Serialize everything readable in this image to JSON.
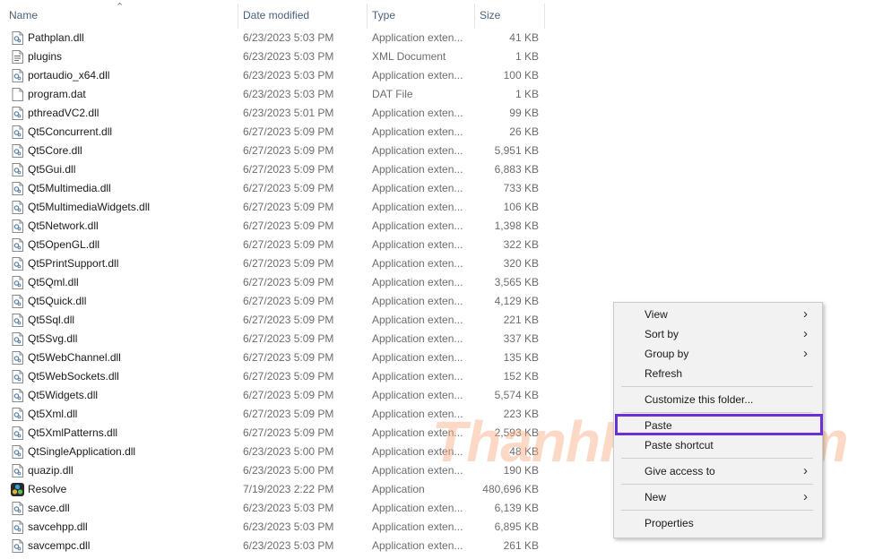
{
  "columns": {
    "name": "Name",
    "date": "Date modified",
    "type": "Type",
    "size": "Size"
  },
  "files": [
    {
      "name": "Pathplan.dll",
      "date": "6/23/2023 5:03 PM",
      "type": "Application exten...",
      "size": "41 KB",
      "icon": "dll-file-icon"
    },
    {
      "name": "plugins",
      "date": "6/23/2023 5:03 PM",
      "type": "XML Document",
      "size": "1 KB",
      "icon": "xml-file-icon"
    },
    {
      "name": "portaudio_x64.dll",
      "date": "6/23/2023 5:03 PM",
      "type": "Application exten...",
      "size": "100 KB",
      "icon": "dll-file-icon"
    },
    {
      "name": "program.dat",
      "date": "6/23/2023 5:03 PM",
      "type": "DAT File",
      "size": "1 KB",
      "icon": "blank-file-icon"
    },
    {
      "name": "pthreadVC2.dll",
      "date": "6/23/2023 5:01 PM",
      "type": "Application exten...",
      "size": "99 KB",
      "icon": "dll-file-icon"
    },
    {
      "name": "Qt5Concurrent.dll",
      "date": "6/27/2023 5:09 PM",
      "type": "Application exten...",
      "size": "26 KB",
      "icon": "dll-file-icon"
    },
    {
      "name": "Qt5Core.dll",
      "date": "6/27/2023 5:09 PM",
      "type": "Application exten...",
      "size": "5,951 KB",
      "icon": "dll-file-icon"
    },
    {
      "name": "Qt5Gui.dll",
      "date": "6/27/2023 5:09 PM",
      "type": "Application exten...",
      "size": "6,883 KB",
      "icon": "dll-file-icon"
    },
    {
      "name": "Qt5Multimedia.dll",
      "date": "6/27/2023 5:09 PM",
      "type": "Application exten...",
      "size": "733 KB",
      "icon": "dll-file-icon"
    },
    {
      "name": "Qt5MultimediaWidgets.dll",
      "date": "6/27/2023 5:09 PM",
      "type": "Application exten...",
      "size": "106 KB",
      "icon": "dll-file-icon"
    },
    {
      "name": "Qt5Network.dll",
      "date": "6/27/2023 5:09 PM",
      "type": "Application exten...",
      "size": "1,398 KB",
      "icon": "dll-file-icon"
    },
    {
      "name": "Qt5OpenGL.dll",
      "date": "6/27/2023 5:09 PM",
      "type": "Application exten...",
      "size": "322 KB",
      "icon": "dll-file-icon"
    },
    {
      "name": "Qt5PrintSupport.dll",
      "date": "6/27/2023 5:09 PM",
      "type": "Application exten...",
      "size": "320 KB",
      "icon": "dll-file-icon"
    },
    {
      "name": "Qt5Qml.dll",
      "date": "6/27/2023 5:09 PM",
      "type": "Application exten...",
      "size": "3,565 KB",
      "icon": "dll-file-icon"
    },
    {
      "name": "Qt5Quick.dll",
      "date": "6/27/2023 5:09 PM",
      "type": "Application exten...",
      "size": "4,129 KB",
      "icon": "dll-file-icon"
    },
    {
      "name": "Qt5Sql.dll",
      "date": "6/27/2023 5:09 PM",
      "type": "Application exten...",
      "size": "221 KB",
      "icon": "dll-file-icon"
    },
    {
      "name": "Qt5Svg.dll",
      "date": "6/27/2023 5:09 PM",
      "type": "Application exten...",
      "size": "337 KB",
      "icon": "dll-file-icon"
    },
    {
      "name": "Qt5WebChannel.dll",
      "date": "6/27/2023 5:09 PM",
      "type": "Application exten...",
      "size": "135 KB",
      "icon": "dll-file-icon"
    },
    {
      "name": "Qt5WebSockets.dll",
      "date": "6/27/2023 5:09 PM",
      "type": "Application exten...",
      "size": "152 KB",
      "icon": "dll-file-icon"
    },
    {
      "name": "Qt5Widgets.dll",
      "date": "6/27/2023 5:09 PM",
      "type": "Application exten...",
      "size": "5,574 KB",
      "icon": "dll-file-icon"
    },
    {
      "name": "Qt5Xml.dll",
      "date": "6/27/2023 5:09 PM",
      "type": "Application exten...",
      "size": "223 KB",
      "icon": "dll-file-icon"
    },
    {
      "name": "Qt5XmlPatterns.dll",
      "date": "6/27/2023 5:09 PM",
      "type": "Application exten...",
      "size": "2,593 KB",
      "icon": "dll-file-icon"
    },
    {
      "name": "QtSingleApplication.dll",
      "date": "6/23/2023 5:00 PM",
      "type": "Application exten...",
      "size": "48 KB",
      "icon": "dll-file-icon"
    },
    {
      "name": "quazip.dll",
      "date": "6/23/2023 5:00 PM",
      "type": "Application exten...",
      "size": "190 KB",
      "icon": "dll-file-icon"
    },
    {
      "name": "Resolve",
      "date": "7/19/2023 2:22 PM",
      "type": "Application",
      "size": "480,696 KB",
      "icon": "resolve-app-icon"
    },
    {
      "name": "savce.dll",
      "date": "6/23/2023 5:03 PM",
      "type": "Application exten...",
      "size": "6,139 KB",
      "icon": "dll-file-icon"
    },
    {
      "name": "savcehpp.dll",
      "date": "6/23/2023 5:03 PM",
      "type": "Application exten...",
      "size": "6,895 KB",
      "icon": "dll-file-icon"
    },
    {
      "name": "savcempc.dll",
      "date": "6/23/2023 5:03 PM",
      "type": "Application exten...",
      "size": "261 KB",
      "icon": "dll-file-icon"
    }
  ],
  "context_menu": {
    "items": [
      {
        "label": "View",
        "submenu": true
      },
      {
        "label": "Sort by",
        "submenu": true
      },
      {
        "label": "Group by",
        "submenu": true
      },
      {
        "label": "Refresh",
        "submenu": false
      },
      {
        "label": "Customize this folder...",
        "submenu": false
      },
      {
        "label": "Paste",
        "submenu": false
      },
      {
        "label": "Paste shortcut",
        "submenu": false
      },
      {
        "label": "Give access to",
        "submenu": true
      },
      {
        "label": "New",
        "submenu": true
      },
      {
        "label": "Properties",
        "submenu": false
      }
    ],
    "highlighted": "Paste"
  },
  "watermark": "ThanhPlus.com",
  "colors": {
    "highlight_border": "#6a2fd6",
    "header_text": "#4c607a",
    "watermark": "#f8aa82"
  }
}
